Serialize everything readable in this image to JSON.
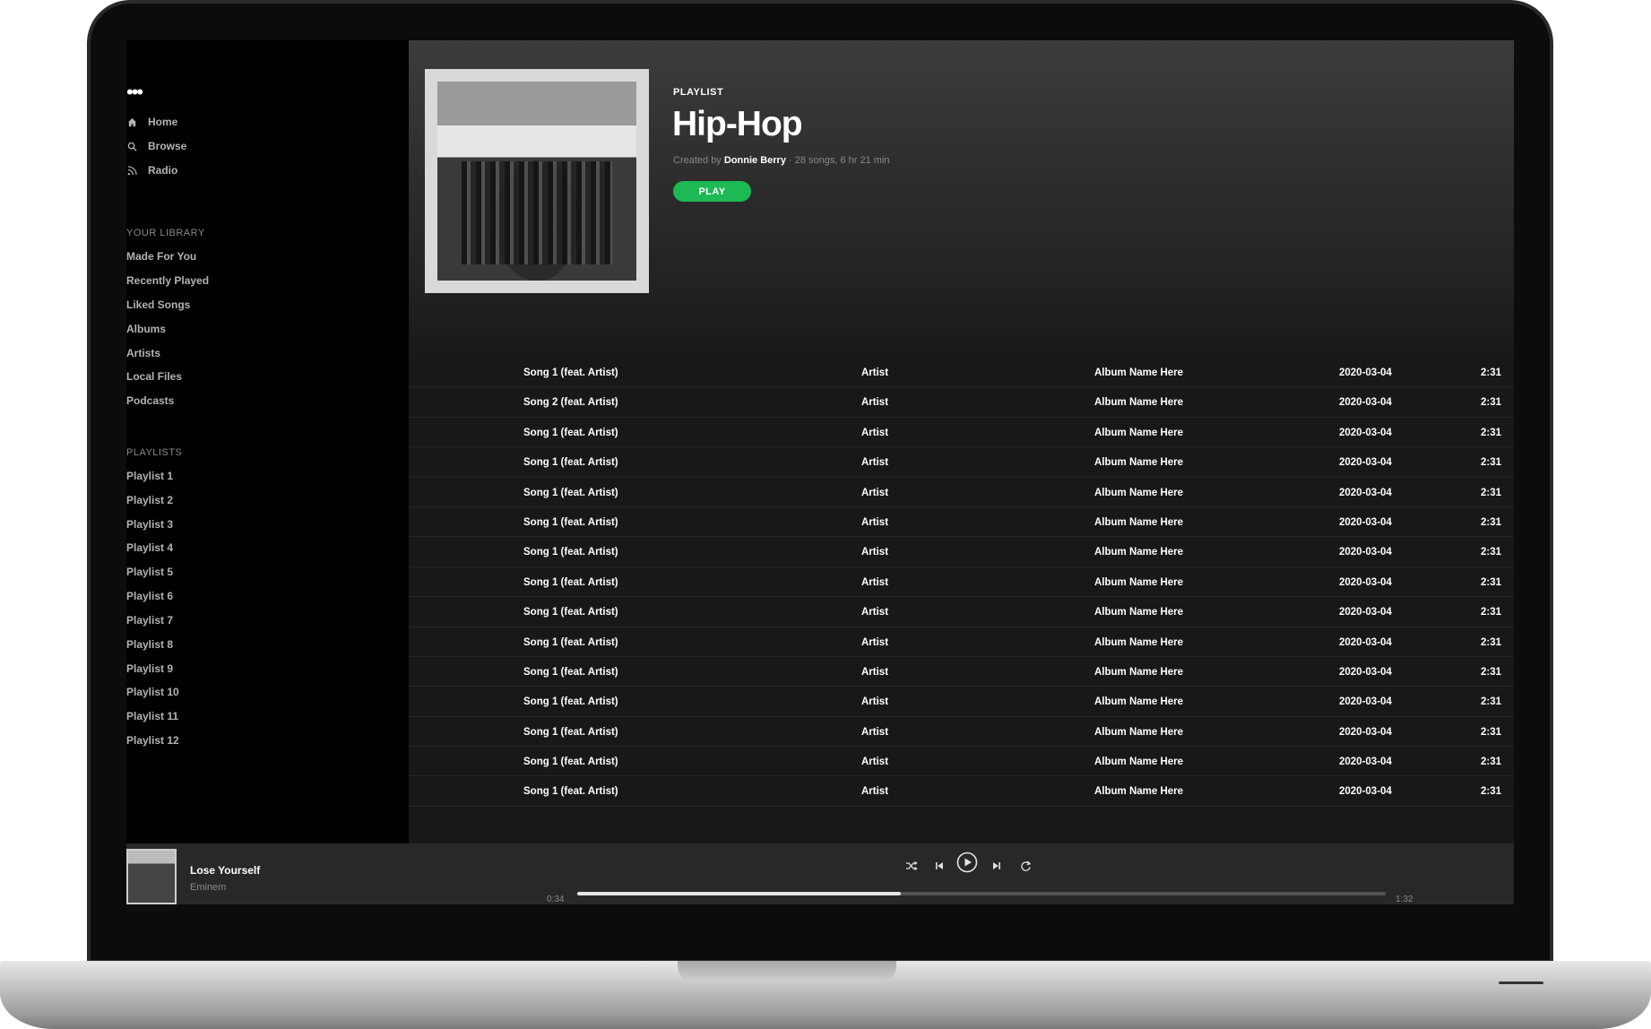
{
  "sidebar": {
    "nav": [
      {
        "label": "Home",
        "icon": "home-icon"
      },
      {
        "label": "Browse",
        "icon": "search-icon"
      },
      {
        "label": "Radio",
        "icon": "radio-icon"
      }
    ],
    "library_title": "YOUR LIBRARY",
    "library": [
      "Made For You",
      "Recently Played",
      "Liked Songs",
      "Albums",
      "Artists",
      "Local Files",
      "Podcasts"
    ],
    "playlists_title": "PLAYLISTS",
    "playlists": [
      "Playlist 1",
      "Playlist 2",
      "Playlist 3",
      "Playlist 4",
      "Playlist 5",
      "Playlist 6",
      "Playlist 7",
      "Playlist 8",
      "Playlist 9",
      "Playlist 10",
      "Playlist 11",
      "Playlist 12"
    ]
  },
  "playlist": {
    "kind": "PLAYLIST",
    "title": "Hip-Hop",
    "created_by": "Created by",
    "owner": "Donnie Berry",
    "stats": "· 28 songs, 6 hr 21 min",
    "play_label": "PLAY"
  },
  "tracks": [
    {
      "title": "Song 1 (feat. Artist)",
      "artist": "Artist",
      "album": "Album Name Here",
      "date": "2020-03-04",
      "duration": "2:31"
    },
    {
      "title": "Song 2 (feat. Artist)",
      "artist": "Artist",
      "album": "Album Name Here",
      "date": "2020-03-04",
      "duration": "2:31"
    },
    {
      "title": "Song 1 (feat. Artist)",
      "artist": "Artist",
      "album": "Album Name Here",
      "date": "2020-03-04",
      "duration": "2:31"
    },
    {
      "title": "Song 1 (feat. Artist)",
      "artist": "Artist",
      "album": "Album Name Here",
      "date": "2020-03-04",
      "duration": "2:31"
    },
    {
      "title": "Song 1 (feat. Artist)",
      "artist": "Artist",
      "album": "Album Name Here",
      "date": "2020-03-04",
      "duration": "2:31"
    },
    {
      "title": "Song 1 (feat. Artist)",
      "artist": "Artist",
      "album": "Album Name Here",
      "date": "2020-03-04",
      "duration": "2:31"
    },
    {
      "title": "Song 1 (feat. Artist)",
      "artist": "Artist",
      "album": "Album Name Here",
      "date": "2020-03-04",
      "duration": "2:31"
    },
    {
      "title": "Song 1 (feat. Artist)",
      "artist": "Artist",
      "album": "Album Name Here",
      "date": "2020-03-04",
      "duration": "2:31"
    },
    {
      "title": "Song 1 (feat. Artist)",
      "artist": "Artist",
      "album": "Album Name Here",
      "date": "2020-03-04",
      "duration": "2:31"
    },
    {
      "title": "Song 1 (feat. Artist)",
      "artist": "Artist",
      "album": "Album Name Here",
      "date": "2020-03-04",
      "duration": "2:31"
    },
    {
      "title": "Song 1 (feat. Artist)",
      "artist": "Artist",
      "album": "Album Name Here",
      "date": "2020-03-04",
      "duration": "2:31"
    },
    {
      "title": "Song 1 (feat. Artist)",
      "artist": "Artist",
      "album": "Album Name Here",
      "date": "2020-03-04",
      "duration": "2:31"
    },
    {
      "title": "Song 1 (feat. Artist)",
      "artist": "Artist",
      "album": "Album Name Here",
      "date": "2020-03-04",
      "duration": "2:31"
    },
    {
      "title": "Song 1 (feat. Artist)",
      "artist": "Artist",
      "album": "Album Name Here",
      "date": "2020-03-04",
      "duration": "2:31"
    },
    {
      "title": "Song 1 (feat. Artist)",
      "artist": "Artist",
      "album": "Album Name Here",
      "date": "2020-03-04",
      "duration": "2:31"
    }
  ],
  "player": {
    "track_title": "Lose Yourself",
    "track_artist": "Eminem",
    "elapsed": "0:34",
    "total": "1:32",
    "progress": 0.4,
    "controls": [
      "shuffle-icon",
      "previous-icon",
      "play-icon",
      "next-icon",
      "repeat-icon"
    ]
  },
  "colors": {
    "accent": "#1db954",
    "background": "#181818",
    "sidebar": "#000000",
    "player": "#282828"
  }
}
